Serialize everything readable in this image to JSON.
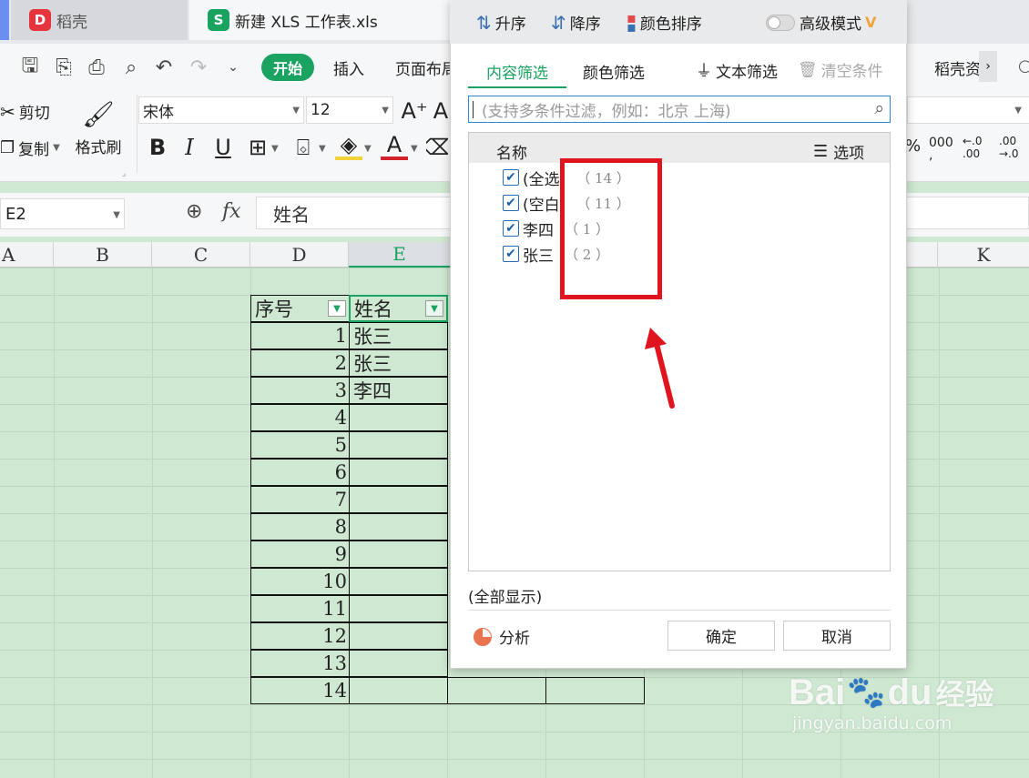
{
  "title_bar": {
    "tabs": [
      {
        "label": "稻壳",
        "icon": "docer-logo-icon"
      },
      {
        "label": "新建 XLS 工作表.xls",
        "icon": "spreadsheet-logo-icon"
      }
    ]
  },
  "menu": {
    "start_tab": "开始",
    "insert_tab": "插入",
    "page_layout_tab": "页面布局",
    "docer_tab": "稻壳资"
  },
  "ribbon": {
    "cut": "剪切",
    "copy": "复制",
    "format_painter": "格式刷",
    "font_name": "宋体",
    "font_size": "12"
  },
  "formula_bar": {
    "name_box": "E2",
    "fx": "fx",
    "content": "姓名"
  },
  "sheet": {
    "columns": [
      "A",
      "B",
      "C",
      "D",
      "E",
      "K"
    ],
    "header_seq": "序号",
    "header_name": "姓名",
    "rows": [
      {
        "seq": "1",
        "name": "张三"
      },
      {
        "seq": "2",
        "name": "张三"
      },
      {
        "seq": "3",
        "name": "李四"
      },
      {
        "seq": "4",
        "name": ""
      },
      {
        "seq": "5",
        "name": ""
      },
      {
        "seq": "6",
        "name": ""
      },
      {
        "seq": "7",
        "name": ""
      },
      {
        "seq": "8",
        "name": ""
      },
      {
        "seq": "9",
        "name": ""
      },
      {
        "seq": "10",
        "name": ""
      },
      {
        "seq": "11",
        "name": ""
      },
      {
        "seq": "12",
        "name": ""
      },
      {
        "seq": "13",
        "name": ""
      },
      {
        "seq": "14",
        "name": ""
      }
    ]
  },
  "filter_dialog": {
    "sort_asc": "升序",
    "sort_desc": "降序",
    "color_sort": "颜色排序",
    "advanced_mode": "高级模式",
    "vip_mark": "V",
    "tab_content": "内容筛选",
    "tab_color": "颜色筛选",
    "text_filter": "文本筛选",
    "clear_conditions": "清空条件",
    "search_placeholder": "(支持多条件过滤，例如：北京 上海)",
    "list_header": "名称",
    "options": "选项",
    "items": [
      {
        "label": "(全选)",
        "count": "（ 14 ）",
        "checked": true
      },
      {
        "label": "(空白)",
        "count": "（ 11 ）",
        "checked": true
      },
      {
        "label": "李四",
        "count": "（ 1 ）",
        "checked": true
      },
      {
        "label": "张三",
        "count": "（ 2 ）",
        "checked": true
      }
    ],
    "show_all": "(全部显示)",
    "analyze": "分析",
    "ok": "确定",
    "cancel": "取消"
  },
  "watermark": {
    "brand_left": "Bai",
    "brand_right": "du",
    "suffix": "经验",
    "url": "jingyan.baidu.com"
  },
  "colors": {
    "accent_green": "#1aa260",
    "annotation_red": "#e0141e",
    "sheet_background": "#cfe8d1"
  }
}
